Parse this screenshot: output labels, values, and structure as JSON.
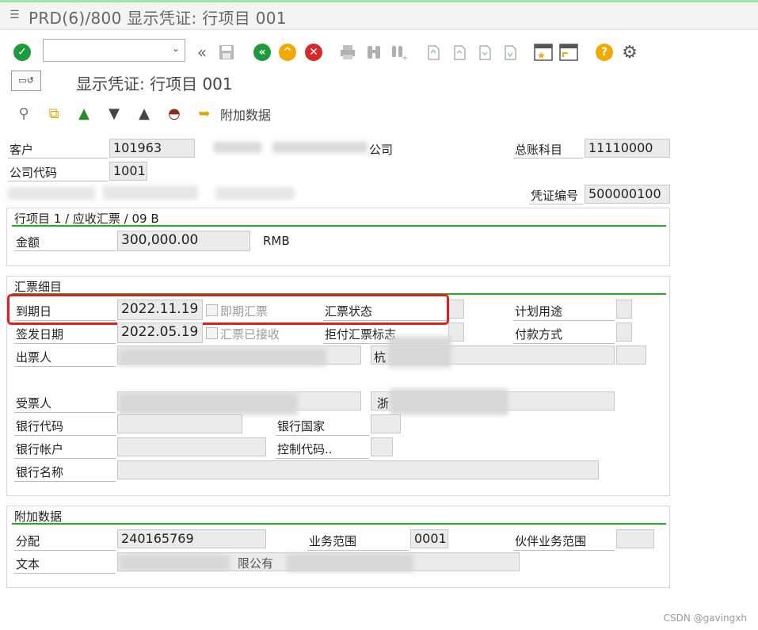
{
  "window": {
    "title": "PRD(6)/800 显示凭证: 行项目 001"
  },
  "page_title": "显示凭证: 行项目 001",
  "app_toolbar": {
    "additional_data_label": "附加数据"
  },
  "header": {
    "customer_label": "客户",
    "customer_value": "101963",
    "company_suffix": "公司",
    "gl_account_label": "总账科目",
    "gl_account_value": "11110000",
    "company_code_label": "公司代码",
    "company_code_value": "1001",
    "doc_number_label": "凭证编号",
    "doc_number_value": "500000100"
  },
  "line_item_group": {
    "title": "行项目 1 / 应收汇票 / 09 B",
    "amount_label": "金额",
    "amount_value": "300,000.00",
    "currency": "RMB"
  },
  "bill_details": {
    "title": "汇票细目",
    "due_date_label": "到期日",
    "due_date_value": "2022.11.19",
    "sight_bill_label": "即期汇票",
    "bill_status_label": "汇票状态",
    "planned_usage_label": "计划用途",
    "issue_date_label": "签发日期",
    "issue_date_value": "2022.05.19",
    "bill_accepted_label": "汇票已接收",
    "protest_flag_label": "拒付汇票标志",
    "payment_method_label": "付款方式",
    "drawer_label": "出票人",
    "drawer_city_prefix": "杭",
    "payee_label": "受票人",
    "payee_city_prefix": "浙",
    "bank_code_label": "银行代码",
    "bank_country_label": "银行国家",
    "bank_account_label": "银行帐户",
    "control_key_label": "控制代码..",
    "bank_name_label": "银行名称"
  },
  "additional_data": {
    "title": "附加数据",
    "assignment_label": "分配",
    "assignment_value": "240165769",
    "business_area_label": "业务范围",
    "business_area_value": "0001",
    "partner_business_area_label": "伙伴业务范围",
    "text_label": "文本",
    "text_visible_fragment": "限公有"
  },
  "watermark": "CSDN @gavingxh",
  "colors": {
    "accent_green": "#2aa82a",
    "highlight_red": "#e0201e",
    "ok_green": "#1f9a3a",
    "nav_orange": "#f2a900",
    "cancel_red": "#d62a2a"
  }
}
